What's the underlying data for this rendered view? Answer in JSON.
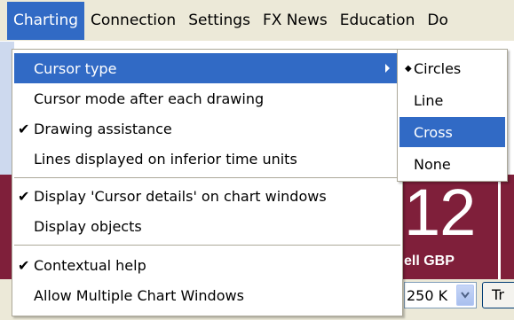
{
  "menubar": {
    "items": [
      {
        "label": "Charting",
        "active": true
      },
      {
        "label": "Connection"
      },
      {
        "label": "Settings"
      },
      {
        "label": "FX News"
      },
      {
        "label": "Education"
      },
      {
        "label": "Do"
      }
    ]
  },
  "charting_menu": {
    "items": [
      {
        "label": "Cursor type",
        "checked": false,
        "has_submenu": true,
        "highlighted": true
      },
      {
        "label": "Cursor mode after each drawing",
        "checked": false
      },
      {
        "label": "Drawing assistance",
        "checked": true,
        "check_glyph": "✔"
      },
      {
        "label": "Lines displayed on inferior time units",
        "checked": false
      },
      {
        "label": "Display 'Cursor details' on chart windows",
        "checked": true,
        "check_glyph": "✔"
      },
      {
        "label": "Display objects",
        "checked": false
      },
      {
        "label": "Contextual help",
        "checked": true,
        "check_glyph": "✔"
      },
      {
        "label": "Allow Multiple Chart Windows",
        "checked": false
      }
    ]
  },
  "cursor_type_submenu": {
    "items": [
      {
        "label": "Circles",
        "selected": true,
        "bullet_glyph": "◆"
      },
      {
        "label": "Line"
      },
      {
        "label": "Cross",
        "highlighted": true
      },
      {
        "label": "None"
      }
    ]
  },
  "background": {
    "price_digits": "12",
    "sell_label": "ell GBP",
    "amount_value": "250 K",
    "button_label": "Tr"
  },
  "colors": {
    "highlight": "#316ac5",
    "menu_face": "#ece9d8",
    "panel_red": "#7f1f3a"
  }
}
